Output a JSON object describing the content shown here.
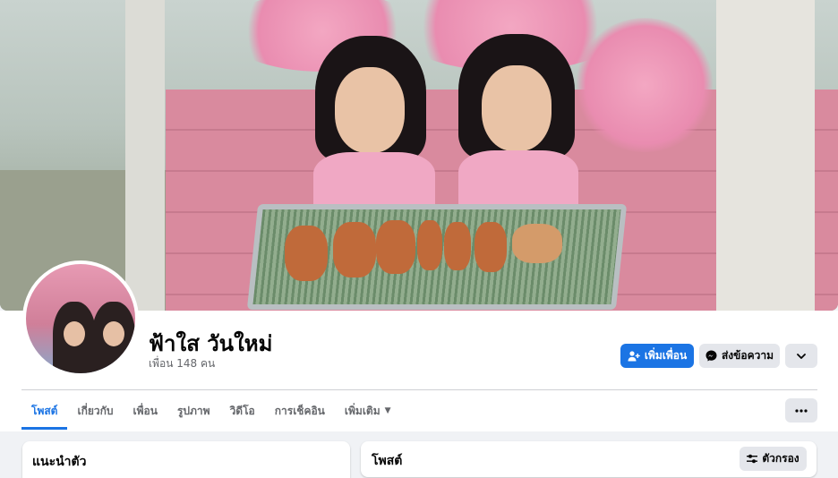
{
  "profile": {
    "name": "ฟ้าใส วันใหม่",
    "friends_count": "เพื่อน 148 คน"
  },
  "actions": {
    "add_friend": "เพิ่มเพื่อน",
    "message": "ส่งข้อความ"
  },
  "tabs": [
    {
      "label": "โพสต์"
    },
    {
      "label": "เกี่ยวกับ"
    },
    {
      "label": "เพื่อน"
    },
    {
      "label": "รูปภาพ"
    },
    {
      "label": "วิดีโอ"
    },
    {
      "label": "การเช็คอิน"
    },
    {
      "label": "เพิ่มเติม"
    }
  ],
  "intro": {
    "title": "แนะนำตัว"
  },
  "posts": {
    "title": "โพสต์",
    "filter_label": "ตัวกรอง"
  },
  "icons": {
    "add_friend": "person-plus-icon",
    "message": "messenger-icon",
    "more": "chevron-down-icon",
    "tab_more": "caret-down-icon",
    "tab_options": "more-dots-icon",
    "filter": "filter-sliders-icon"
  },
  "colors": {
    "accent": "#1b74e4",
    "secondary_bg": "#e4e6eb",
    "page_bg": "#f0f2f5"
  }
}
